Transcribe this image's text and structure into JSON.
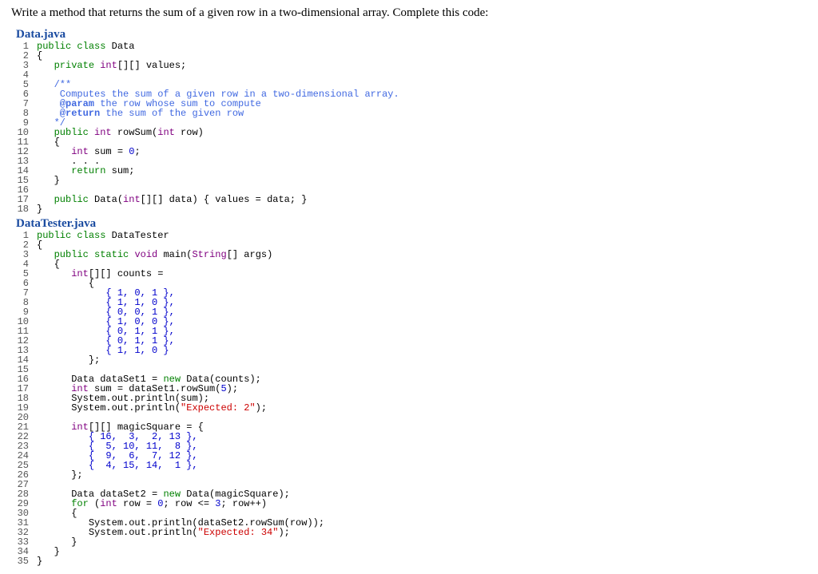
{
  "instruction": "Write a method that returns the sum of a given row in a two-dimensional array. Complete this code:",
  "file1": {
    "name": "Data.java",
    "lines": [
      "1",
      "2",
      "3",
      "4",
      "5",
      "6",
      "7",
      "8",
      "9",
      "10",
      "11",
      "12",
      "13",
      "14",
      "15",
      "16",
      "17",
      "18"
    ],
    "tokens": {
      "l1_public": "public",
      "l1_class": "class",
      "l1_Data": "Data",
      "l3_private": "private",
      "l3_int": "int",
      "l3_values": "[][] values;",
      "l5_doc": "/**",
      "l6_doc": "    Computes the sum of a given row in a two-dimensional array.",
      "l7_param": "    @param",
      "l7_rest": " the row whose sum to compute",
      "l8_return": "    @return",
      "l8_rest": " the sum of the given row",
      "l9_doc": "*/",
      "l10_public": "public",
      "l10_int": "int",
      "l10_rest": " rowSum(",
      "l10_int2": "int",
      "l10_rest2": " row)",
      "l12_int": "int",
      "l12_rest": " sum = ",
      "l12_zero": "0",
      "l12_semi": ";",
      "l13_dots": ". . .",
      "l14_return": "return",
      "l14_rest": " sum;",
      "l17_public": "public",
      "l17_rest": " Data(",
      "l17_int": "int",
      "l17_rest2": "[][] data) { values = data; }"
    }
  },
  "file2": {
    "name": "DataTester.java",
    "lines": [
      "1",
      "2",
      "3",
      "4",
      "5",
      "6",
      "7",
      "8",
      "9",
      "10",
      "11",
      "12",
      "13",
      "14",
      "15",
      "16",
      "17",
      "18",
      "19",
      "20",
      "21",
      "22",
      "23",
      "24",
      "25",
      "26",
      "27",
      "28",
      "29",
      "30",
      "31",
      "32",
      "33",
      "34",
      "35"
    ],
    "tokens": {
      "l1_public": "public",
      "l1_class": "class",
      "l1_name": "DataTester",
      "l3_public": "public",
      "l3_static": "static",
      "l3_void": "void",
      "l3_main": " main(",
      "l3_String": "String",
      "l3_rest": "[] args)",
      "l5_int": "int",
      "l5_rest": "[][] counts =",
      "r7": "{ 1, 0, 1 },",
      "r8": "{ 1, 1, 0 },",
      "r9": "{ 0, 0, 1 },",
      "r10": "{ 1, 0, 0 },",
      "r11": "{ 0, 1, 1 },",
      "r12": "{ 0, 1, 1 },",
      "r13": "{ 1, 1, 0 }",
      "l14_close": "};",
      "l16_new": "new",
      "l16_a": "Data dataSet1 = ",
      "l16_b": " Data(counts);",
      "l17_int": "int",
      "l17_a": " sum = dataSet1.rowSum(",
      "l17_5": "5",
      "l17_b": ");",
      "l18": "System.out.println(sum);",
      "l19_a": "System.out.println(",
      "l19_s": "\"Expected: 2\"",
      "l19_b": ");",
      "l21_int": "int",
      "l21_rest": "[][] magicSquare = {",
      "m22": "{ 16,  3,  2, 13 },",
      "m23": "{  5, 10, 11,  8 },",
      "m24": "{  9,  6,  7, 12 },",
      "m25": "{  4, 15, 14,  1 },",
      "l26_close": "};",
      "l28_new": "new",
      "l28_a": "Data dataSet2 = ",
      "l28_b": " Data(magicSquare);",
      "l29_for": "for",
      "l29_a": " (",
      "l29_int": "int",
      "l29_b": " row = ",
      "l29_0": "0",
      "l29_c": "; row <= ",
      "l29_3": "3",
      "l29_d": "; row++)",
      "l31": "System.out.println(dataSet2.rowSum(row));",
      "l32_a": "System.out.println(",
      "l32_s": "\"Expected: 34\"",
      "l32_b": ");"
    }
  }
}
